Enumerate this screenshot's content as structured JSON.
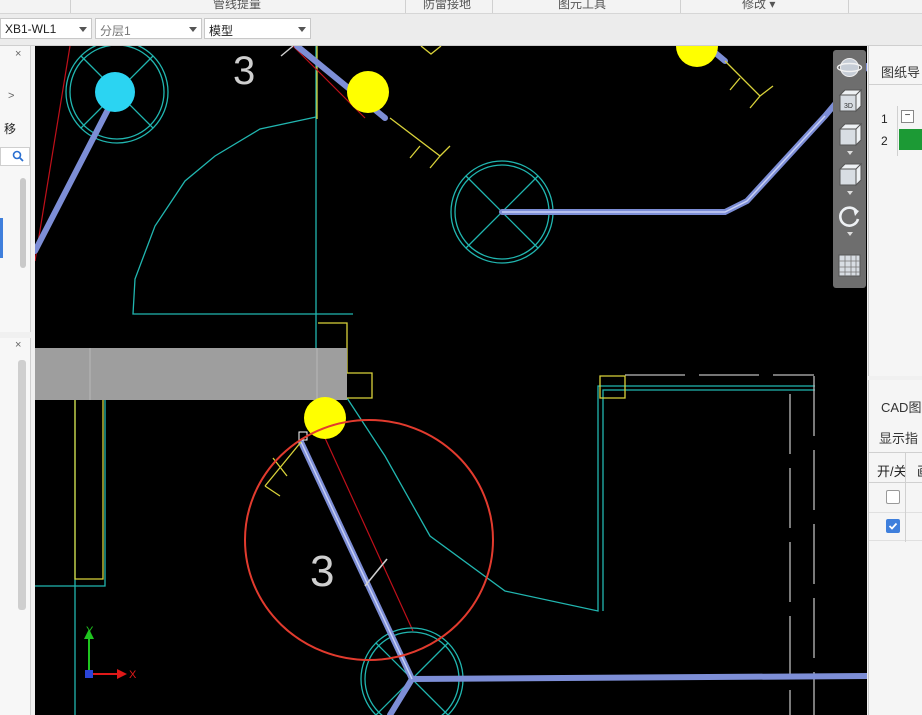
{
  "ribbon": {
    "tabs": [
      "管线提量",
      "防雷接地",
      "图元工具",
      "修改 ▾"
    ]
  },
  "toolbar": {
    "combo1": "XB1-WL1",
    "combo2": "分层1",
    "combo3": "模型"
  },
  "left_panel": {
    "close": "×",
    "letter": "移",
    "chev": ">"
  },
  "drawing": {
    "label_top": "3",
    "label_circle": "3",
    "axis_y": "Y",
    "axis_x": "X"
  },
  "right_top": {
    "title": "图纸导",
    "rows": [
      "1",
      "2"
    ],
    "tree_toggle": "−"
  },
  "right_bottom": {
    "title": "CAD图",
    "subtitle": "显示指",
    "col_header": "开/关",
    "col_header2": "画",
    "checkboxes": [
      false,
      true
    ]
  },
  "colors": {
    "canvas_bg": "#000000",
    "pipe": "#7d8ed6",
    "wall_cyan": "#21b6b0",
    "yellow_wall": "#d9d23a",
    "node_yellow": "#ffff00",
    "node_cyan": "#2bd4f2",
    "highlight_circle": "#e23b2e",
    "red_line": "#c0101a"
  },
  "icons": [
    "globe-icon",
    "3d-view-icon",
    "cube-icon",
    "cube-down-icon",
    "rotate-icon",
    "grid-view-icon"
  ]
}
